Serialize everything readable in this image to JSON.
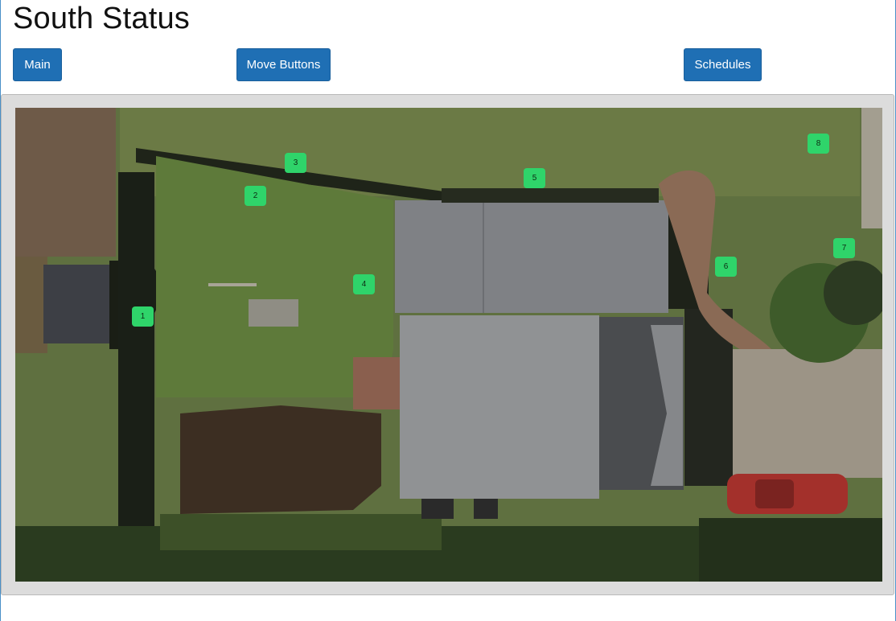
{
  "page": {
    "title": "South Status"
  },
  "nav": {
    "main_label": "Main",
    "move_buttons_label": "Move Buttons",
    "schedules_label": "Schedules"
  },
  "map": {
    "markers": [
      {
        "label": "1"
      },
      {
        "label": "2"
      },
      {
        "label": "3"
      },
      {
        "label": "4"
      },
      {
        "label": "5"
      },
      {
        "label": "6"
      },
      {
        "label": "7"
      },
      {
        "label": "8"
      }
    ],
    "marker_color": "#2fd46a"
  },
  "colors": {
    "button": "#1f6fb4",
    "panel": "#dcdcdc",
    "accent_border": "#4a90c8"
  }
}
